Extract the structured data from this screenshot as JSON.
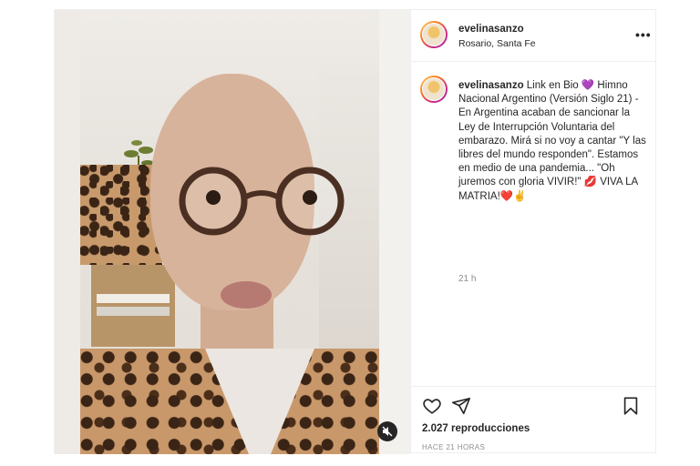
{
  "header": {
    "username": "evelinasanzo",
    "location": "Rosario, Santa Fe",
    "more_label": "•••"
  },
  "caption": {
    "username": "evelinasanzo",
    "text_1": " Link en Bio ",
    "emoji_heart": "💜",
    "text_2": " Himno Nacional Argentino (Versión Siglo 21) - En Argentina acaban de sancionar la Ley de Interrupción Voluntaria del embarazo. Mirá si no voy a cantar \"Y las libres del mundo responden\". Estamos en medio de una pandemia... \"Oh juremos con gloria VIVIR!\" ",
    "emoji_lips": "💋",
    "text_3": " VIVA LA MATRIA!",
    "emoji_red_heart": "❤️",
    "emoji_victory": "✌️"
  },
  "post_time": "21 h",
  "stats": {
    "views": "2.027 reproducciones",
    "ago": "HACE 21 HORAS"
  },
  "icons": {
    "like": "heart-icon",
    "share": "paper-plane-icon",
    "save": "bookmark-icon",
    "mute": "speaker-muted-icon",
    "more": "ellipsis-icon"
  },
  "colors": {
    "text": "#262626",
    "secondary": "#8e8e8e",
    "border": "#efefef",
    "purple_heart": "#8e5fd4"
  }
}
